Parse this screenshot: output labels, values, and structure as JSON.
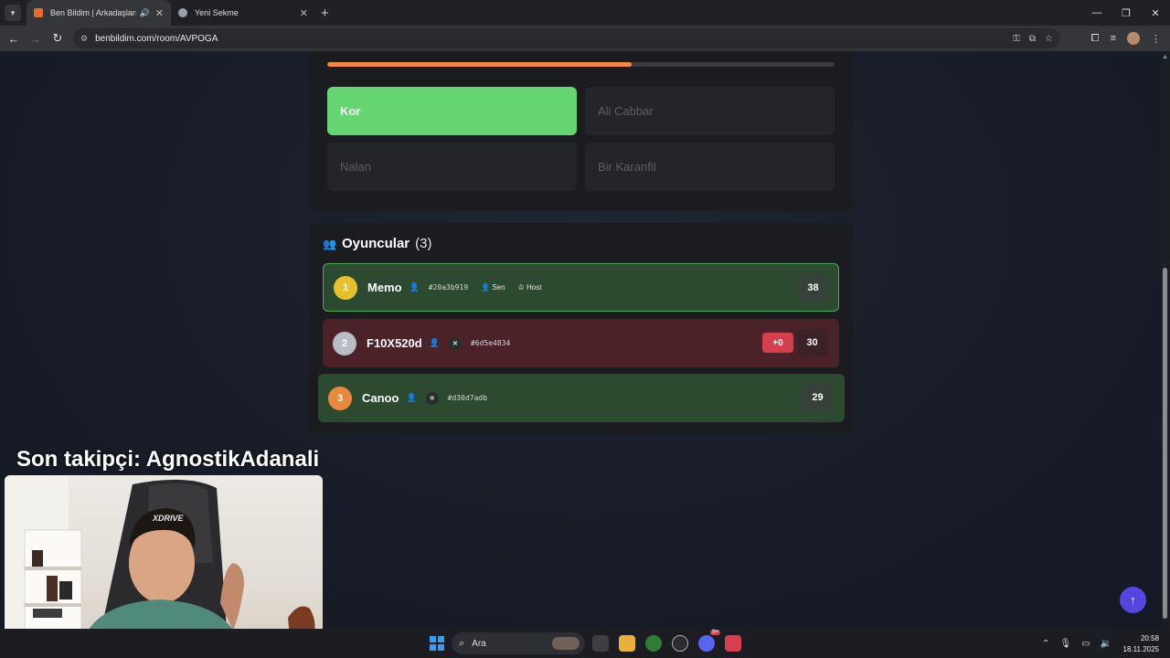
{
  "browser": {
    "tabs": [
      {
        "title": "Ben Bildim | Arkadaşlarınla",
        "active": true
      },
      {
        "title": "Yeni Sekme",
        "active": false
      }
    ],
    "url": "benbildim.com/room/AVPOGA"
  },
  "quiz": {
    "progress_percent": 60,
    "options": [
      {
        "label": "Kor",
        "state": "correct"
      },
      {
        "label": "Ali Cabbar",
        "state": "disabled"
      },
      {
        "label": "Nalan",
        "state": "disabled"
      },
      {
        "label": "Bir Karanfil",
        "state": "disabled"
      }
    ]
  },
  "players": {
    "title": "Oyuncular",
    "count_label": "(3)",
    "list": [
      {
        "rank": "1",
        "name": "Memo",
        "id": "#20a3b919",
        "you_label": "Sen",
        "host_label": "Host",
        "score": "38"
      },
      {
        "rank": "2",
        "name": "F10X520d",
        "id": "#6d5e4834",
        "delta": "+0",
        "score": "30"
      },
      {
        "rank": "3",
        "name": "Canoo",
        "id": "#d30d7adb",
        "score": "29"
      }
    ]
  },
  "overlay": {
    "follower_text": "Son takipçi: AgnostikAdanali",
    "chair_brand": "XDRIVE"
  },
  "taskbar": {
    "search_placeholder": "Ara",
    "badge": "9+",
    "time": "20:58",
    "date": "18.11.2025"
  },
  "colors": {
    "accent": "#f28a3a",
    "correct": "#65d672",
    "row_green": "#2c4a2f",
    "row_red": "#4a2228",
    "rank_gold": "#e5c22b",
    "rank_silver": "#b9bcc4",
    "rank_bronze": "#e88a3d",
    "delta": "#d6404e",
    "scroll_button": "#5646e0"
  }
}
